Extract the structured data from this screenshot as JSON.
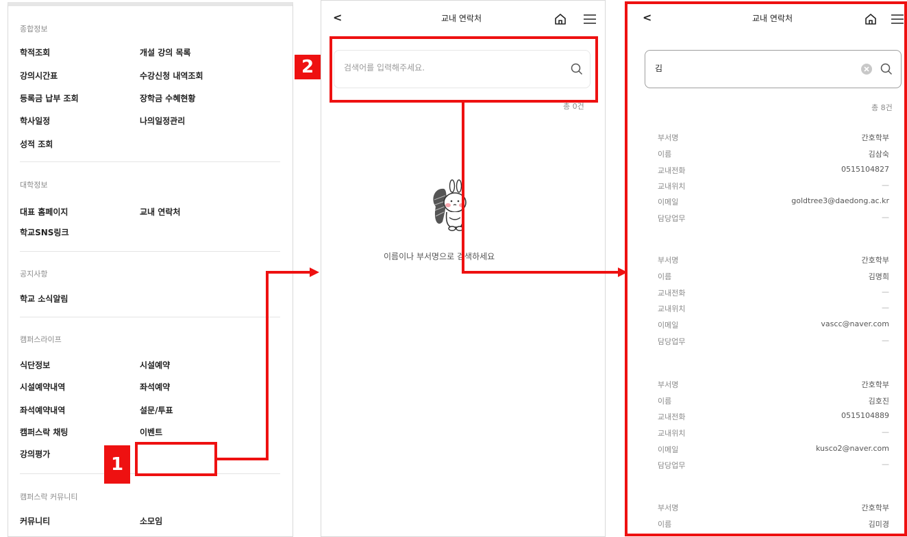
{
  "menu": {
    "sections": [
      {
        "title": "종합정보",
        "items": [
          "학적조회",
          "개설 강의 목록",
          "강의시간표",
          "수강신청 내역조회",
          "등록금 납부 조회",
          "장학금 수혜현황",
          "학사일정",
          "나의일정관리",
          "성적 조회"
        ]
      },
      {
        "title": "대학정보",
        "items": [
          "대표 홈페이지",
          "교내 연락처",
          "학교SNS링크"
        ]
      },
      {
        "title": "공지사항",
        "items": [
          "학교 소식알림"
        ]
      },
      {
        "title": "캠퍼스라이프",
        "items": [
          "식단정보",
          "시설예약",
          "시설예약내역",
          "좌석예약",
          "좌석예약내역",
          "설문/투표",
          "캠퍼스락 채팅",
          "이벤트",
          "강의평가"
        ]
      },
      {
        "title": "캠퍼스락 커뮤니티",
        "items": [
          "커뮤니티",
          "소모임"
        ]
      }
    ]
  },
  "mid_screen": {
    "back": "<",
    "title": "교내 연락처",
    "search_placeholder": "검색어를 입력해주세요.",
    "total": "총 0건",
    "empty_message": "이름이나 부서명으로 검색하세요"
  },
  "right_screen": {
    "back": "<",
    "title": "교내 연락처",
    "search_value": "김",
    "total": "총 8건",
    "labels": {
      "dept": "부서명",
      "name": "이름",
      "phone": "교내전화",
      "location": "교내위치",
      "email": "이메일",
      "duty": "담당업무"
    },
    "contacts": [
      {
        "dept": "간호학부",
        "name": "김삼숙",
        "phone": "0515104827",
        "location": "—",
        "email": "goldtree3@daedong.ac.kr",
        "duty": "—"
      },
      {
        "dept": "간호학부",
        "name": "김명희",
        "phone": "—",
        "location": "—",
        "email": "vascc@naver.com",
        "duty": "—"
      },
      {
        "dept": "간호학부",
        "name": "김호진",
        "phone": "0515104889",
        "location": "—",
        "email": "kusco2@naver.com",
        "duty": "—"
      },
      {
        "dept": "간호학부",
        "name": "김미경"
      }
    ]
  },
  "annotations": {
    "badge1": "1",
    "badge2": "2",
    "color": "#ee1111"
  }
}
